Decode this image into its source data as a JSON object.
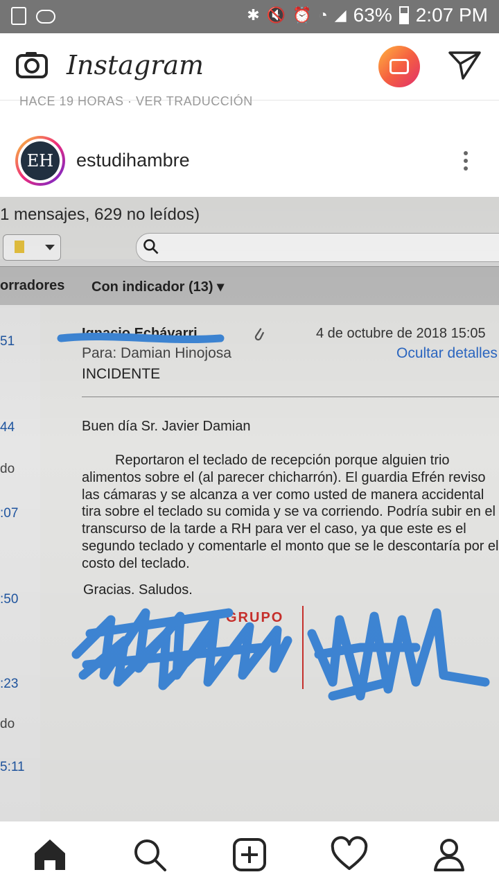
{
  "status_bar": {
    "battery": "63%",
    "time": "2:07 PM"
  },
  "header": {
    "logo": "Instagram"
  },
  "caption_peek": "HACE 19 HORAS · VER TRADUCCIÓN",
  "post": {
    "avatar_text": "EH",
    "username": "estudihambre"
  },
  "photo": {
    "title_partial": "1 mensajes, 629 no leídos)",
    "tab_left": "orradores",
    "tab_flagged": "Con indicador (13) ▾",
    "list_times": [
      "51",
      "44",
      "do",
      ":07",
      ":50",
      ":23",
      "do",
      "5:11"
    ],
    "from": "Ignacio Echávarri",
    "date": "4 de octubre de 2018 15:05",
    "to": "Para:  Damian Hinojosa",
    "hide_details": "Ocultar detalles",
    "subject": "INCIDENTE",
    "greeting": "Buen día Sr. Javier Damian",
    "body": "Reportaron el teclado de recepción porque alguien trio alimentos sobre el (al parecer chicharrón). El guardia Efrén reviso las cámaras y se alcanza a ver como usted de manera accidental tira sobre el teclado su comida y se va corriendo. Podría subir en el transcurso de la tarde a RH para ver el caso, ya que este es el segundo teclado y comentarle el monto que se le descontaría por el costo del teclado.",
    "thanks": "Gracias. Saludos.",
    "logo_text": "GRUPO"
  },
  "colors": {
    "status_bg": "#757575",
    "scribble": "#3e86d6",
    "link": "#2b67c3",
    "brand_red": "#c9302c"
  },
  "nav": {
    "icons": [
      "home-icon",
      "search-icon",
      "new-post-icon",
      "heart-icon",
      "profile-icon"
    ]
  }
}
